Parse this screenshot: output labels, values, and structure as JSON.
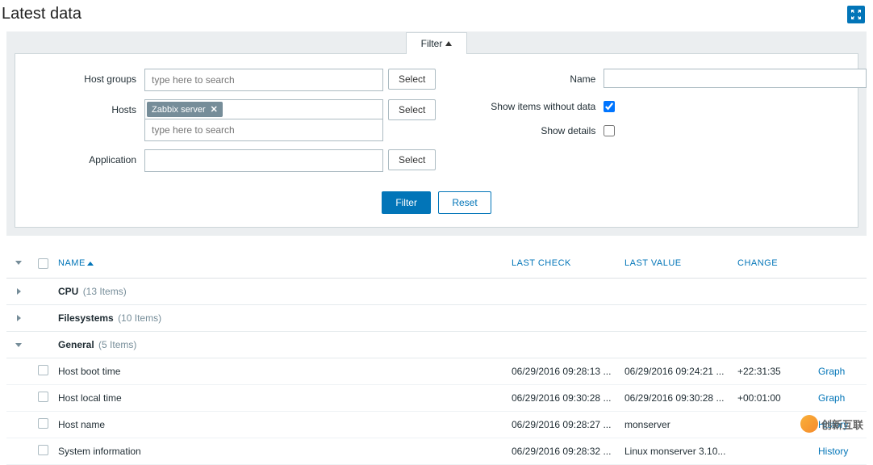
{
  "header": {
    "title": "Latest data"
  },
  "filter": {
    "tab_label": "Filter",
    "host_groups_label": "Host groups",
    "host_groups_placeholder": "type here to search",
    "hosts_label": "Hosts",
    "hosts_selected": "Zabbix server",
    "hosts_placeholder": "type here to search",
    "application_label": "Application",
    "name_label": "Name",
    "show_without_data_label": "Show items without data",
    "show_without_data_checked": true,
    "show_details_label": "Show details",
    "show_details_checked": false,
    "select_button": "Select",
    "filter_button": "Filter",
    "reset_button": "Reset"
  },
  "table": {
    "header_name": "NAME",
    "header_last_check": "LAST CHECK",
    "header_last_value": "LAST VALUE",
    "header_change": "CHANGE",
    "groups": [
      {
        "name": "CPU",
        "count": "(13 Items)",
        "expanded": false
      },
      {
        "name": "Filesystems",
        "count": "(10 Items)",
        "expanded": false
      },
      {
        "name": "General",
        "count": "(5 Items)",
        "expanded": true
      }
    ],
    "items": [
      {
        "name": "Host boot time",
        "last_check": "06/29/2016 09:28:13 ...",
        "last_value": "06/29/2016 09:24:21 ...",
        "change": "+22:31:35",
        "action": "Graph"
      },
      {
        "name": "Host local time",
        "last_check": "06/29/2016 09:30:28 ...",
        "last_value": "06/29/2016 09:30:28 ...",
        "change": "+00:01:00",
        "action": "Graph"
      },
      {
        "name": "Host name",
        "last_check": "06/29/2016 09:28:27 ...",
        "last_value": "monserver",
        "change": "",
        "action": "History"
      },
      {
        "name": "System information",
        "last_check": "06/29/2016 09:28:32 ...",
        "last_value": "Linux monserver 3.10...",
        "change": "",
        "action": "History"
      }
    ]
  },
  "watermark": "创新互联"
}
